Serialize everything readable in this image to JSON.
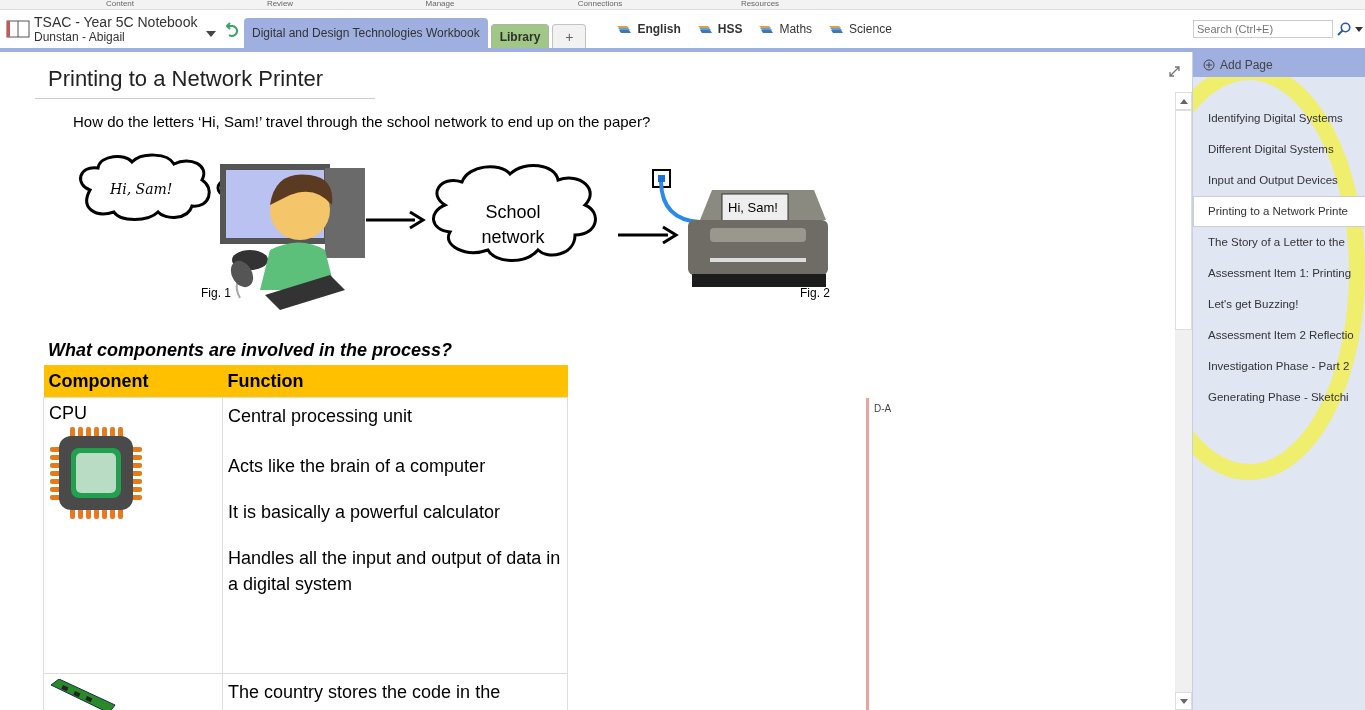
{
  "ribbon_groups": [
    "Content",
    "Review",
    "Manage",
    "Connections",
    "Resources"
  ],
  "notebook": {
    "title": "TSAC - Year 5C Notebook",
    "owner": "Dunstan - Abigail"
  },
  "section_tabs": [
    {
      "label": "Digital and Design Technologies Workbook",
      "selected": true,
      "color": "#9fb0e0",
      "kind": "section"
    },
    {
      "label": "Library",
      "selected": false,
      "color": "#a9d18e",
      "kind": "section"
    },
    {
      "label": "+",
      "selected": false,
      "kind": "add"
    }
  ],
  "section_groups": [
    {
      "label": "English",
      "unread": true
    },
    {
      "label": "HSS",
      "unread": true
    },
    {
      "label": "Maths",
      "unread": false
    },
    {
      "label": "Science",
      "unread": false
    }
  ],
  "search": {
    "placeholder": "Search (Ctrl+E)"
  },
  "page": {
    "title": "Printing to a Network Printer",
    "question": "How do the letters ‘Hi, Sam!’ travel through the school network to end up on the paper?",
    "figure": {
      "thought": "Hi, Sam!",
      "cloud": "School network",
      "paper": "Hi, Sam!",
      "captions": [
        "Fig. 1",
        "Fig. 2"
      ]
    },
    "heading": "What components are involved in the process?",
    "table": {
      "columns": [
        "Component",
        "Function"
      ],
      "rows": [
        {
          "component": "CPU",
          "kind": "cpu",
          "function": [
            "Central processing unit",
            "Acts like the brain of a computer",
            "It is basically a powerful calculator",
            "Handles all the input and output of data in a digital system"
          ]
        },
        {
          "component": "",
          "kind": "memory",
          "function": [
            "The country stores the code in the"
          ]
        }
      ]
    },
    "note": "D-A"
  },
  "pages": {
    "add_label": "Add Page",
    "items": [
      {
        "label": "Identifying Digital Systems",
        "selected": false
      },
      {
        "label": "Different Digital Systems",
        "selected": false
      },
      {
        "label": "Input and Output Devices",
        "selected": false
      },
      {
        "label": "Printing to a Network Printe",
        "selected": true
      },
      {
        "label": "The Story of a Letter to the",
        "selected": false
      },
      {
        "label": "Assessment Item 1: Printing",
        "selected": false
      },
      {
        "label": "Let's get Buzzing!",
        "selected": false
      },
      {
        "label": "Assessment Item 2 Reflectio",
        "selected": false
      },
      {
        "label": "Investigation Phase - Part 2",
        "selected": false
      },
      {
        "label": "Generating Phase - Sketchi",
        "selected": false
      }
    ]
  }
}
